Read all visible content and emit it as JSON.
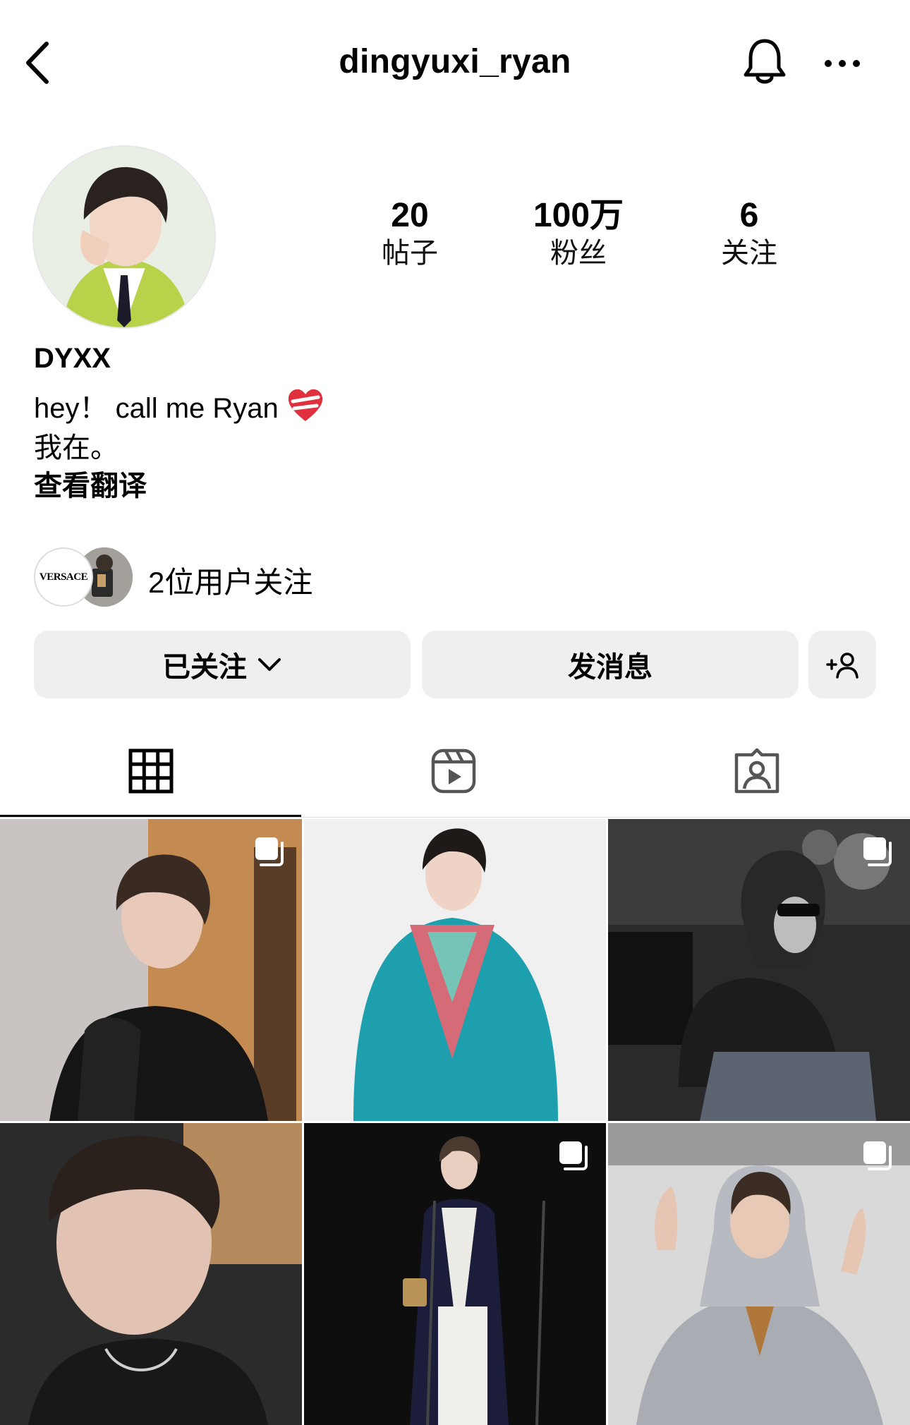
{
  "header": {
    "username": "dingyuxi_ryan"
  },
  "stats": [
    {
      "value": "20",
      "label": "帖子"
    },
    {
      "value": "100万",
      "label": "粉丝"
    },
    {
      "value": "6",
      "label": "关注"
    }
  ],
  "bio": {
    "display_name": "DYXX",
    "line1": "hey！ call me Ryan",
    "line2": "我在。",
    "translate": "查看翻译"
  },
  "followed_by": {
    "text": "2位用户关注",
    "avatar1_text": "VERSACE"
  },
  "actions": {
    "follow_label": "已关注",
    "message_label": "发消息"
  },
  "icons": {
    "back": "chevron-left-icon",
    "bell": "bell-icon",
    "more": "more-horizontal-icon",
    "grid": "grid-icon",
    "reels": "reels-icon",
    "tagged": "tagged-icon",
    "multi": "multi-photo-icon",
    "add_person": "add-person-icon",
    "heart": "mending-heart-icon"
  },
  "colors": {
    "button_bg": "#efefef",
    "text": "#000000",
    "separator": "#dbdbdb"
  }
}
